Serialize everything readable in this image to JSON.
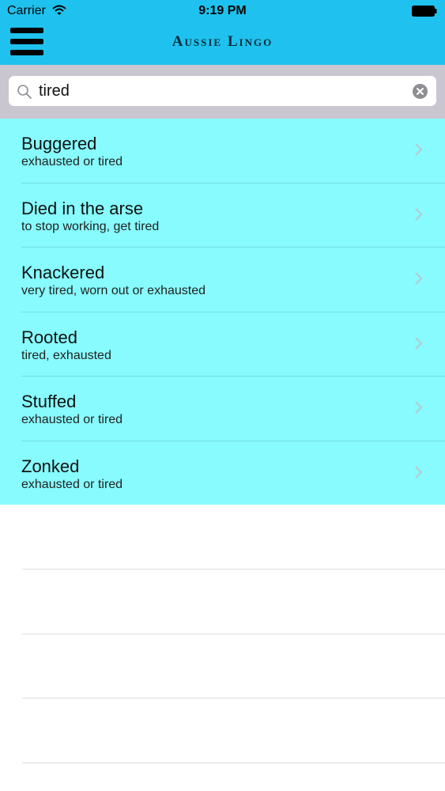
{
  "status_bar": {
    "carrier": "Carrier",
    "time": "9:19 PM",
    "wifi_icon": "wifi-icon",
    "battery_icon": "battery-icon"
  },
  "nav_bar": {
    "title": "Aussie Lingo",
    "menu_icon": "hamburger-menu-icon",
    "color": "#1fc2ee"
  },
  "search": {
    "value": "tired",
    "search_icon": "search-icon",
    "clear_icon": "clear-icon"
  },
  "results": {
    "background": "#87fbfd",
    "items": [
      {
        "term": "Buggered",
        "meaning": "exhausted or tired"
      },
      {
        "term": "Died in the arse",
        "meaning": "to stop working, get tired"
      },
      {
        "term": "Knackered",
        "meaning": "very tired, worn out or exhausted"
      },
      {
        "term": "Rooted",
        "meaning": "tired, exhausted"
      },
      {
        "term": "Stuffed",
        "meaning": "exhausted or tired"
      },
      {
        "term": "Zonked",
        "meaning": "exhausted or tired"
      }
    ]
  }
}
